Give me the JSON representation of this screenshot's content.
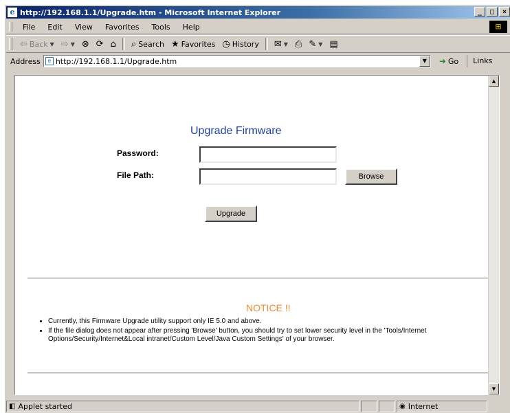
{
  "window": {
    "title": "http://192.168.1.1/Upgrade.htm - Microsoft Internet Explorer",
    "buttons": {
      "minimize": "_",
      "maximize": "□",
      "close": "×"
    }
  },
  "menu": {
    "items": [
      {
        "label": "File"
      },
      {
        "label": "Edit"
      },
      {
        "label": "View"
      },
      {
        "label": "Favorites"
      },
      {
        "label": "Tools"
      },
      {
        "label": "Help"
      }
    ]
  },
  "toolbar": {
    "back": "Back",
    "search": "Search",
    "favorites": "Favorites",
    "history": "History"
  },
  "address": {
    "label": "Address",
    "url": "http://192.168.1.1/Upgrade.htm",
    "go": "Go",
    "links": "Links"
  },
  "page": {
    "title": "Upgrade Firmware",
    "password_label": "Password:",
    "password_value": "",
    "file_path_label": "File Path:",
    "file_path_value": "",
    "browse_button": "Browse",
    "upgrade_button": "Upgrade",
    "notice_title": "NOTICE !!",
    "notices": [
      "Currently, this Firmware Upgrade utility support only IE 5.0 and above.",
      "If the file dialog does not appear after pressing 'Browse' button, you should try to set lower security level in the 'Tools/Internet Options/Security/Internet&Local intranet/Custom Level/Java Custom Settings' of your browser."
    ]
  },
  "status": {
    "message": "Applet started",
    "zone": "Internet"
  },
  "colors": {
    "title_bar": "#0a246a",
    "page_title": "#1f3fa0",
    "notice_title": "#f08a30",
    "chrome": "#d4d0c8"
  }
}
